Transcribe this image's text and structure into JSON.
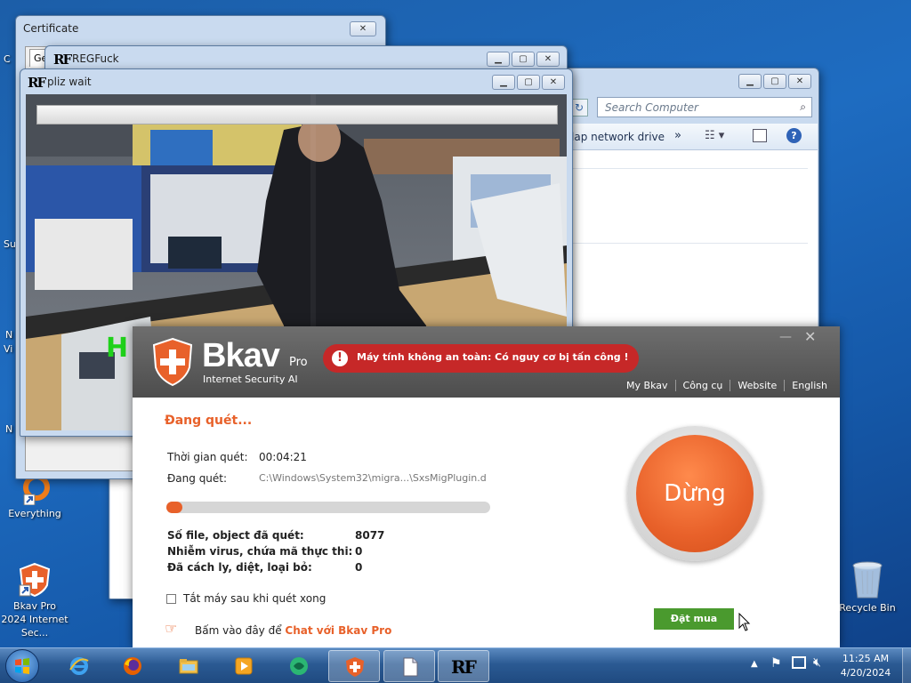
{
  "desktop": {
    "icons": [
      {
        "label": "Everything"
      },
      {
        "label": "Bkav Pro 2024 Internet Sec..."
      },
      {
        "label": "Recycle Bin"
      }
    ],
    "edge_fragments": [
      "C",
      "Su",
      "N",
      "Vi",
      "N"
    ]
  },
  "windows": {
    "certificate": {
      "title": "Certificate",
      "tab": "Ge"
    },
    "regfuck": {
      "title": "REGFuck"
    },
    "pliz": {
      "title": "pliz wait",
      "video_text": "H"
    },
    "explorer": {
      "search_placeholder": "Search Computer",
      "toolbar_map": "lap network drive",
      "toolbar_more": "»"
    }
  },
  "bkav": {
    "brand": "Bkav",
    "edition": "Pro",
    "tagline": "Internet Security AI",
    "alert": "Máy tính không an toàn: Có nguy cơ bị tấn công !",
    "nav": [
      "My Bkav",
      "Công cụ",
      "Website",
      "English"
    ],
    "status_heading": "Đang quét...",
    "time_label": "Thời gian quét:",
    "time_value": "00:04:21",
    "scanning_label": "Đang quét:",
    "scanning_value": "C:\\Windows\\System32\\migra...\\SxsMigPlugin.d",
    "progress": 0.04,
    "stats": [
      {
        "label": "Số file, object đã quét:",
        "value": "8077"
      },
      {
        "label": "Nhiễm virus, chứa mã thực thi:",
        "value": "0"
      },
      {
        "label": "Đã cách ly, diệt, loại bỏ:",
        "value": "0"
      }
    ],
    "shutdown_label": "Tắt máy sau khi quét xong",
    "chat_prefix": "Bấm vào đây để",
    "chat_link": "Chat với Bkav Pro",
    "stop_button": "Dừng",
    "buy_button": "Đặt mua"
  },
  "taskbar": {
    "clock_time": "11:25 AM",
    "clock_date": "4/20/2024"
  },
  "colors": {
    "bkav_orange": "#e8612a",
    "bkav_alert": "#c62828",
    "buy_green": "#4a9a2e",
    "desktop_blue": "#1e6cc1"
  }
}
